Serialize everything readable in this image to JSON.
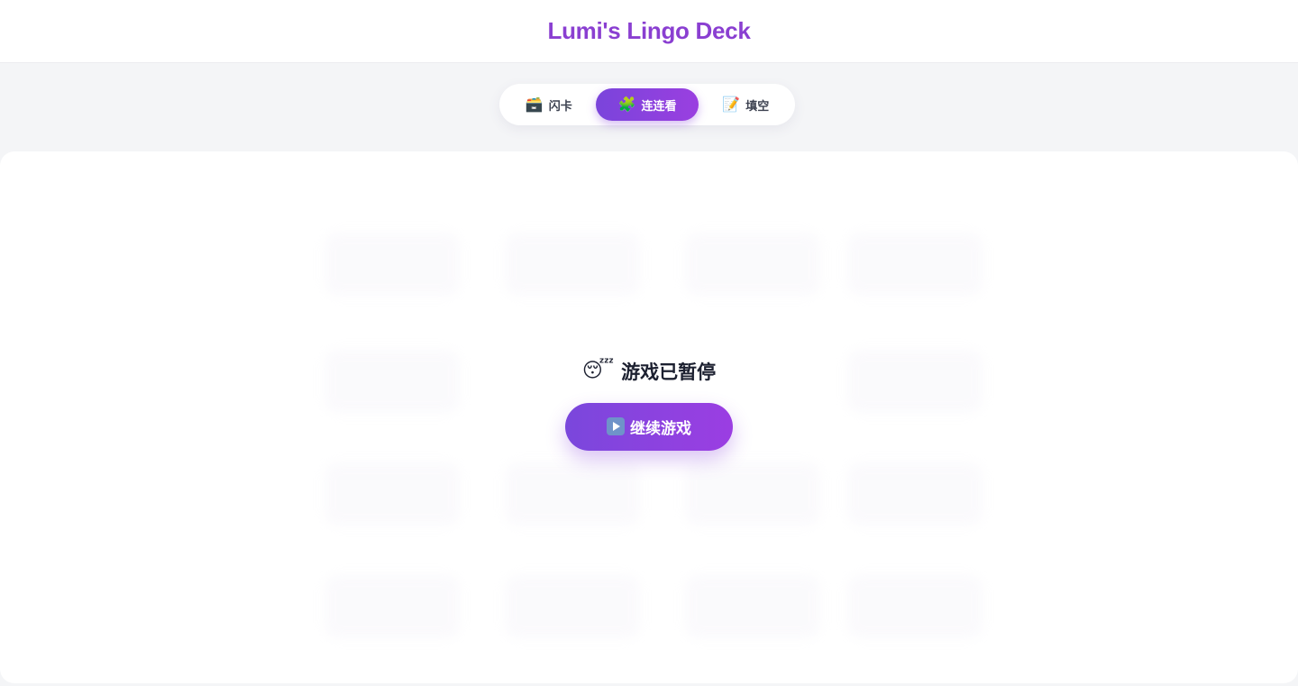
{
  "app": {
    "title": "Lumi's Lingo Deck"
  },
  "tabs": [
    {
      "label": "闪卡",
      "icon": "🗃️",
      "active": false
    },
    {
      "label": "连连看",
      "icon": "🧩",
      "active": true
    },
    {
      "label": "填空",
      "icon": "📝",
      "active": false
    }
  ],
  "pause": {
    "emoji": "😴",
    "title": "游戏已暂停",
    "resume_label": "继续游戏"
  },
  "colors": {
    "accent": "#8a3fd1",
    "accent_gradient_start": "#7a47dc",
    "accent_gradient_end": "#9b3ee2"
  }
}
